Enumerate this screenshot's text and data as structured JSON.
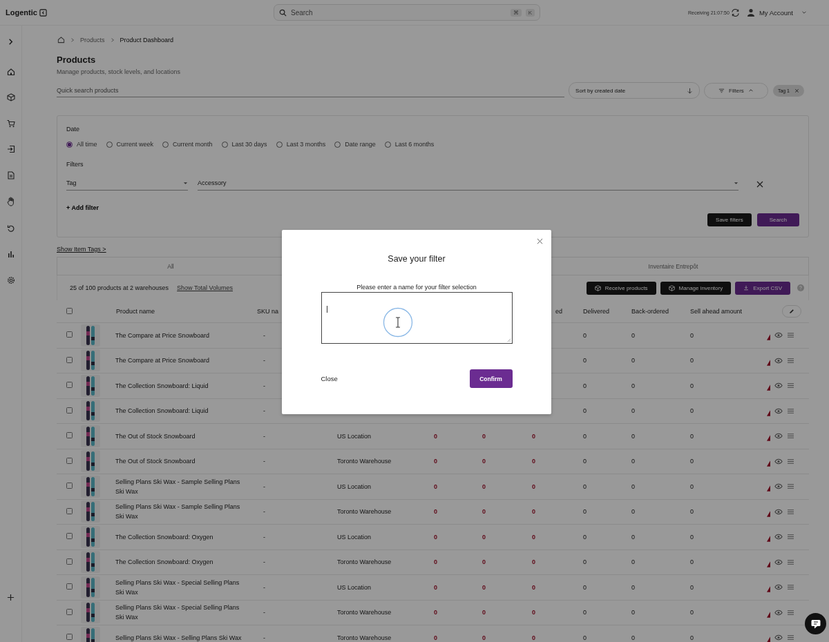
{
  "app": {
    "logo": "Logentic"
  },
  "search": {
    "placeholder": "Search",
    "keys": [
      "⌘",
      "K"
    ]
  },
  "header": {
    "receiving": "Receiving 21:07:50",
    "account": "My Account"
  },
  "breadcrumb": [
    "Products",
    "Product Dashboard"
  ],
  "page": {
    "title": "Products",
    "subtitle": "Manage products, stock levels, and locations"
  },
  "quick_search": {
    "placeholder": "Quick search products"
  },
  "sort": {
    "value": "Sort by created date"
  },
  "filters_toggle": {
    "label": "Filters",
    "expanded": true
  },
  "chips": [
    {
      "label": "Tag 1"
    }
  ],
  "filter_panel": {
    "date_label": "Date",
    "date_options": [
      {
        "label": "All time",
        "selected": true
      },
      {
        "label": "Current week",
        "selected": false
      },
      {
        "label": "Current month",
        "selected": false
      },
      {
        "label": "Last 30 days",
        "selected": false
      },
      {
        "label": "Last 3 months",
        "selected": false
      },
      {
        "label": "Date range",
        "selected": false
      },
      {
        "label": "Last 6 months",
        "selected": false
      }
    ],
    "filters_label": "Filters",
    "filter_rows": [
      {
        "field": "Tag",
        "value": "Accessory"
      }
    ],
    "add_filter": "+ Add filter",
    "save_button": "Save filters",
    "search_button": "Search"
  },
  "show_item_tags": "Show Item Tags >",
  "tabs": [
    {
      "label": "All",
      "selected": false
    },
    {
      "label": "Inventaire Entrepôt",
      "selected": false
    }
  ],
  "summary": "25 of 100 products at 2 warehouses",
  "total_volumes_link": "Show Total Volumes",
  "actions": [
    {
      "label": "Receive products",
      "kind": "receive"
    },
    {
      "label": "Manage inventory",
      "kind": "manage"
    },
    {
      "label": "Export CSV",
      "kind": "export"
    }
  ],
  "table": {
    "select_all_checked": false,
    "columns": {
      "product_name": "Product name",
      "sku": "SKU na",
      "column_7": "ed",
      "delivered": "Delivered",
      "back_ordered": "Back-ordered",
      "sell_ahead_amount": "Sell ahead amount"
    },
    "rows": [
      {
        "checked": false,
        "name": "The Compare at Price Snowboard",
        "sku": "-",
        "delivered": "0",
        "back_ordered": "0",
        "sell_ahead_amount": "0"
      },
      {
        "checked": false,
        "name": "The Compare at Price Snowboard",
        "sku": "-",
        "delivered": "0",
        "back_ordered": "0",
        "sell_ahead_amount": "0"
      },
      {
        "checked": false,
        "name": "The Collection Snowboard: Liquid",
        "sku": "-",
        "delivered": "0",
        "back_ordered": "0",
        "sell_ahead_amount": "0"
      },
      {
        "checked": false,
        "name": "The Collection Snowboard: Liquid",
        "sku": "-",
        "delivered": "0",
        "back_ordered": "0",
        "sell_ahead_amount": "0"
      },
      {
        "checked": false,
        "name": "The Out of Stock Snowboard",
        "sku": "-",
        "location": "US Location",
        "column_5": "0",
        "column_6": "0",
        "column_7": "0",
        "delivered": "0",
        "back_ordered": "0",
        "sell_ahead_amount": "0"
      },
      {
        "checked": false,
        "name": "The Out of Stock Snowboard",
        "sku": "-",
        "location": "Toronto Warehouse",
        "column_5": "0",
        "column_6": "0",
        "column_7": "0",
        "delivered": "0",
        "back_ordered": "0",
        "sell_ahead_amount": "0"
      },
      {
        "checked": false,
        "name": "Selling Plans Ski Wax - Sample Selling Plans Ski Wax",
        "sku": "-",
        "location": "US Location",
        "column_5": "0",
        "column_6": "0",
        "column_7": "0",
        "delivered": "0",
        "back_ordered": "0",
        "sell_ahead_amount": "0"
      },
      {
        "checked": false,
        "name": "Selling Plans Ski Wax - Sample Selling Plans Ski Wax",
        "sku": "-",
        "location": "Toronto Warehouse",
        "column_5": "0",
        "column_6": "0",
        "column_7": "0",
        "delivered": "0",
        "back_ordered": "0",
        "sell_ahead_amount": "0"
      },
      {
        "checked": false,
        "name": "The Collection Snowboard: Oxygen",
        "sku": "-",
        "location": "US Location",
        "column_5": "0",
        "column_6": "0",
        "column_7": "0",
        "delivered": "0",
        "back_ordered": "0",
        "sell_ahead_amount": "0"
      },
      {
        "checked": false,
        "name": "The Collection Snowboard: Oxygen",
        "sku": "-",
        "location": "Toronto Warehouse",
        "column_5": "0",
        "column_6": "0",
        "column_7": "0",
        "delivered": "0",
        "back_ordered": "0",
        "sell_ahead_amount": "0"
      },
      {
        "checked": false,
        "name": "Selling Plans Ski Wax - Special Selling Plans Ski Wax",
        "sku": "-",
        "location": "US Location",
        "column_5": "0",
        "column_6": "0",
        "column_7": "0",
        "delivered": "0",
        "back_ordered": "0",
        "sell_ahead_amount": "0"
      },
      {
        "checked": false,
        "name": "Selling Plans Ski Wax - Special Selling Plans Ski Wax",
        "sku": "-",
        "location": "Toronto Warehouse",
        "column_5": "0",
        "column_6": "0",
        "column_7": "0",
        "delivered": "0",
        "back_ordered": "0",
        "sell_ahead_amount": "0"
      },
      {
        "checked": false,
        "name": "Selling Plans Ski Wax - Selling Plans Ski Wax",
        "sku": "-",
        "location": "Toronto Warehouse",
        "column_5": "0",
        "column_6": "0",
        "column_7": "0",
        "delivered": "0",
        "back_ordered": "0",
        "sell_ahead_amount": "0"
      }
    ]
  },
  "modal": {
    "title": "Save your filter",
    "label": "Please enter a name for your filter selection",
    "close": "Close",
    "confirm": "Confirm"
  }
}
